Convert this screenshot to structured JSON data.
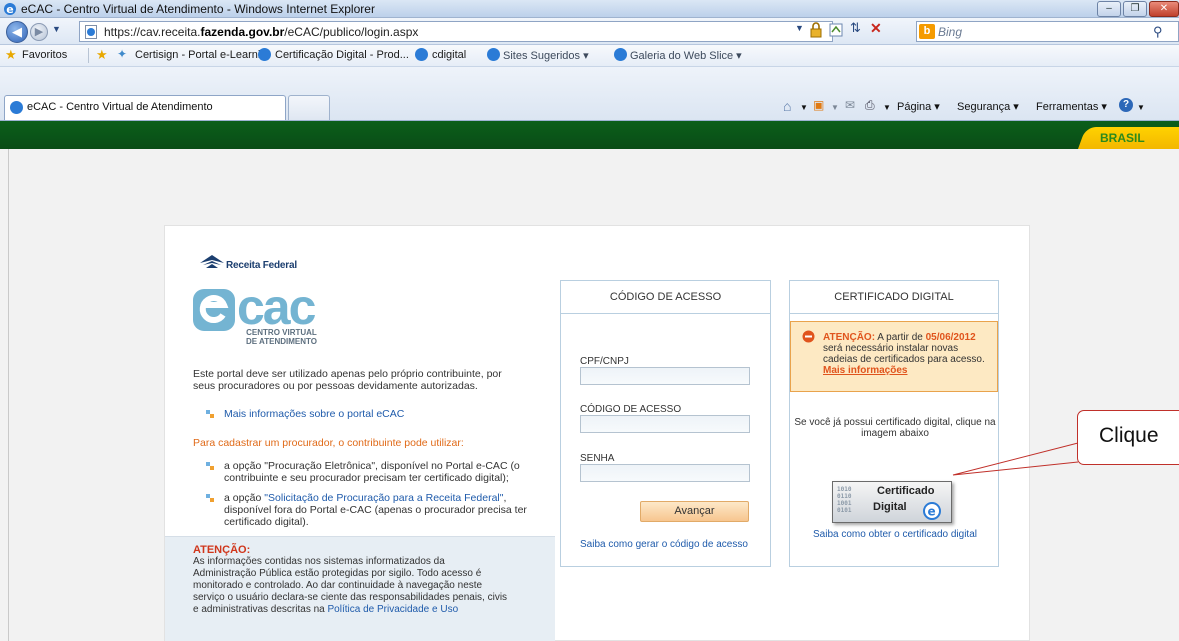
{
  "window": {
    "title": "eCAC - Centro Virtual de Atendimento - Windows Internet Explorer"
  },
  "address_bar": {
    "url_prefix": "https://cav.receita.",
    "url_domain": "fazenda.gov.br",
    "url_path": "/eCAC/publico/login.aspx",
    "search_placeholder": "Bing"
  },
  "favorites_bar": {
    "favorites_label": "Favoritos",
    "items": [
      "Certisign - Portal e-Learni...",
      "Certificação Digital - Prod...",
      "cdigital",
      "Sites Sugeridos ▾",
      "Galeria do Web Slice ▾"
    ]
  },
  "tabs": {
    "active_tab": "eCAC - Centro Virtual de Atendimento"
  },
  "command_bar": {
    "pagina": "Página ▾",
    "seguranca": "Segurança ▾",
    "ferramentas": "Ferramentas ▾"
  },
  "gov_bar": {
    "brasil": "BRASIL"
  },
  "left": {
    "rf_name": "Receita Federal",
    "ecac_word": "cac",
    "ecac_sub_1": "CENTRO VIRTUAL",
    "ecac_sub_2": "DE ATENDIMENTO",
    "intro": "Este portal deve ser utilizado apenas pelo próprio contribuinte, por seus procuradores ou por pessoas devidamente autorizadas.",
    "link_mais_info": "Mais informações sobre o portal eCAC",
    "procurador_heading": "Para cadastrar um procurador, o contribuinte pode utilizar:",
    "option1": "a opção \"Procuração Eletrônica\", disponível no Portal e-CAC (o contribuinte e seu procurador precisam ter certificado digital);",
    "option2_prefix": "a opção ",
    "option2_link": "\"Solicitação de Procuração para a Receita Federal\"",
    "option2_suffix": ", disponível fora do Portal e-CAC (apenas o procurador precisa ter certificado digital).",
    "attention_title": "ATENÇÃO:",
    "attention_text": "As informações contidas nos sistemas informatizados da Administração Pública estão protegidas por sigilo. Todo acesso é monitorado e controlado. Ao dar continuidade à navegação neste serviço o usuário declara-se ciente das responsabilidades penais, civis e administrativas descritas na ",
    "attention_link": "Política de Privacidade e Uso"
  },
  "access_code": {
    "heading": "CÓDIGO DE ACESSO",
    "cpf_label": "CPF/CNPJ",
    "code_label": "CÓDIGO DE ACESSO",
    "password_label": "SENHA",
    "submit": "Avançar",
    "help_link": "Saiba como gerar o código de acesso"
  },
  "certificate": {
    "heading": "CERTIFICADO DIGITAL",
    "alert_strong": "ATENÇÃO:",
    "alert_pre": " A partir de ",
    "alert_date": "05/06/2012",
    "alert_rest": " será necessário instalar novas cadeias de certificados para acesso.",
    "alert_link": "Mais informações",
    "instruction": "Se você já possui certificado digital, clique na imagem abaixo",
    "button_line1": "Certificado",
    "button_line2": "Digital",
    "help_link": "Saiba como obter o certificado digital"
  },
  "callout": {
    "text": "Clique"
  },
  "colors": {
    "gov_green": "#0b5f1a",
    "brasil_yellow": "#ffd200",
    "link_blue": "#1f5bab",
    "accent_orange": "#e06a18",
    "alert_red": "#e0541d"
  }
}
